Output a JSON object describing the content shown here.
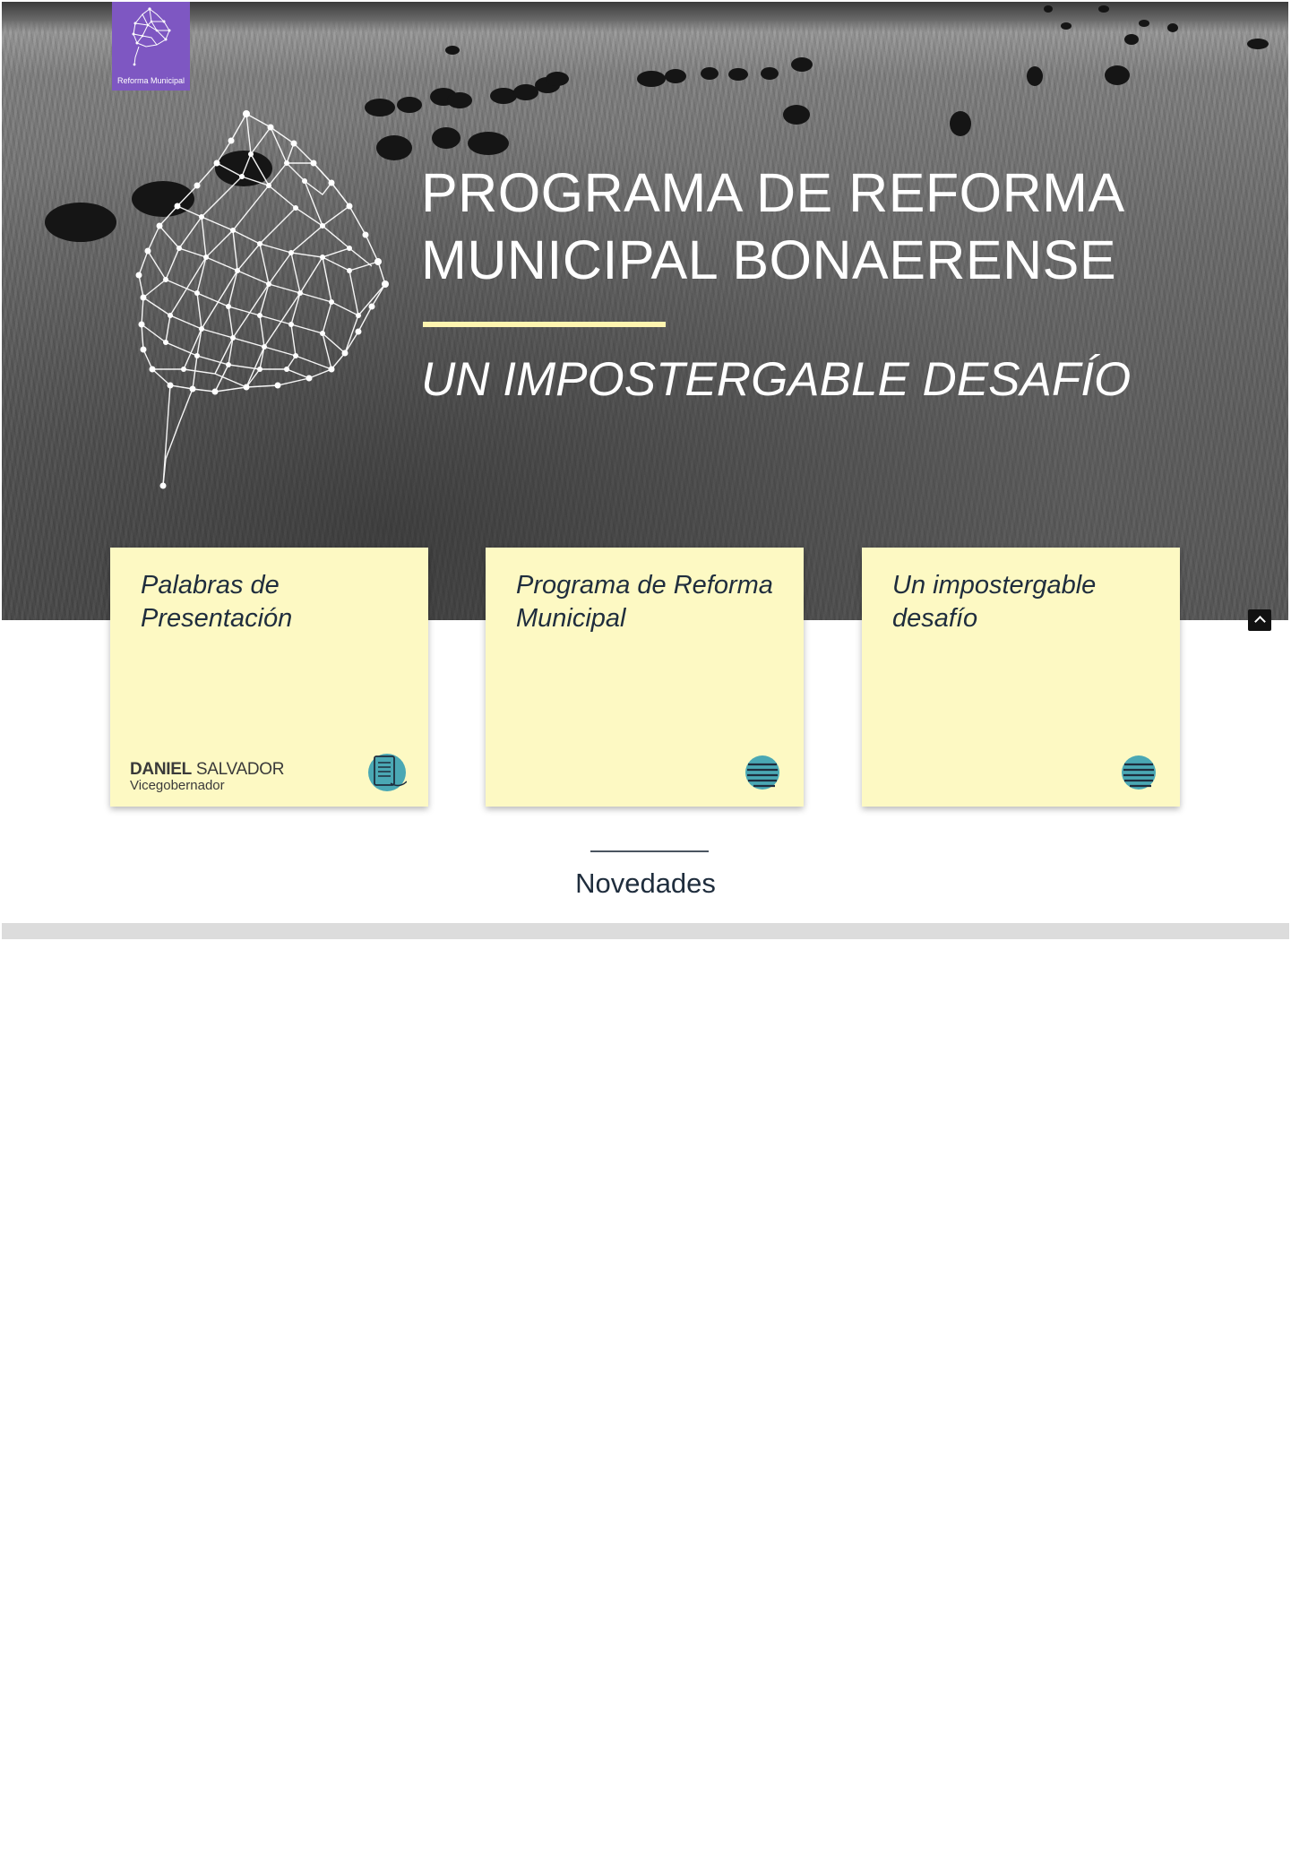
{
  "logo": {
    "text": "Reforma Municipal",
    "color": "#7e57c2"
  },
  "hero": {
    "title_line1": "PROGRAMA DE REFORMA",
    "title_line2": "MUNICIPAL BONAERENSE",
    "subtitle": "UN IMPOSTERGABLE DESAFÍO",
    "accent_color": "#fff5b0"
  },
  "cards": [
    {
      "title": "Palabras de Presentación",
      "person_first": "DANIEL",
      "person_last": " SALVADOR",
      "person_role": "Vicegobernador",
      "icon": "document-icon"
    },
    {
      "title": "Programa de Reforma Municipal",
      "icon": "menu-lines-icon"
    },
    {
      "title": "Un impostergable desafío",
      "icon": "menu-lines-icon"
    }
  ],
  "news": {
    "title": "Novedades"
  },
  "colors": {
    "card_bg": "#fdf9c3",
    "icon_teal": "#4aa8b4",
    "text_dark": "#1f2d3d"
  }
}
